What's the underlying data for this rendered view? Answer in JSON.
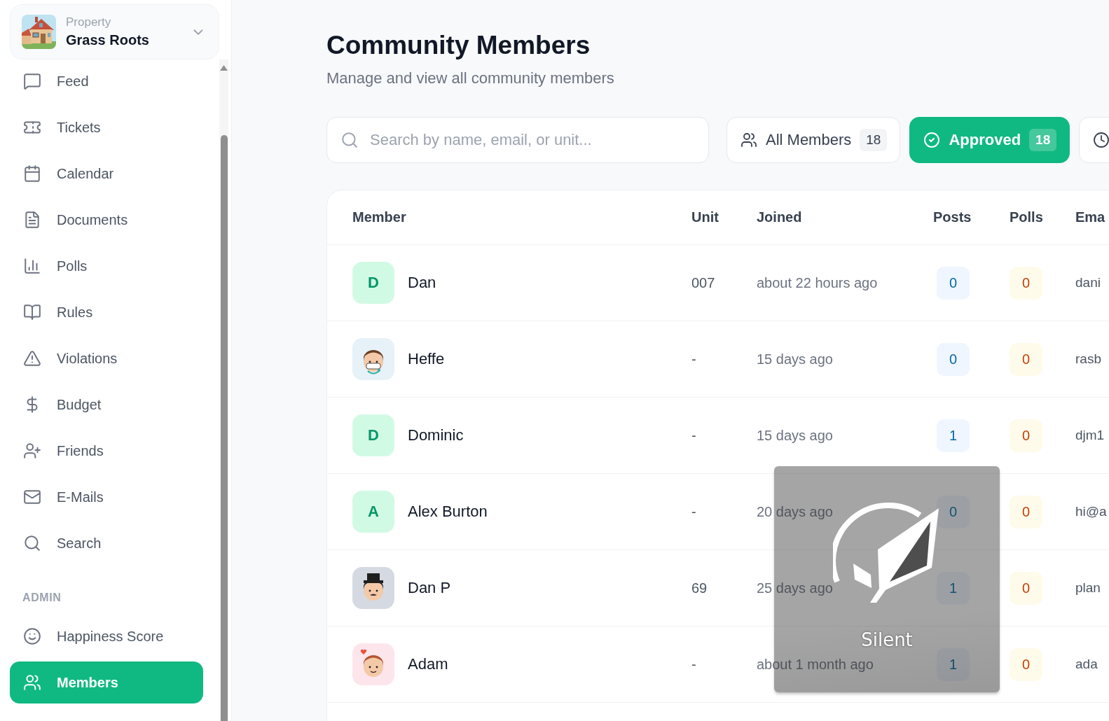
{
  "sidebar": {
    "property": {
      "caption": "Property",
      "name": "Grass Roots"
    },
    "nav": [
      {
        "label": "Feed",
        "selected": false
      },
      {
        "label": "Tickets",
        "selected": false
      },
      {
        "label": "Calendar",
        "selected": false
      },
      {
        "label": "Documents",
        "selected": false
      },
      {
        "label": "Polls",
        "selected": false
      },
      {
        "label": "Rules",
        "selected": false
      },
      {
        "label": "Violations",
        "selected": false
      },
      {
        "label": "Budget",
        "selected": false
      },
      {
        "label": "Friends",
        "selected": false
      },
      {
        "label": "E-Mails",
        "selected": false
      },
      {
        "label": "Search",
        "selected": false
      }
    ],
    "admin": {
      "heading": "ADMIN",
      "items": [
        {
          "label": "Happiness Score",
          "selected": false
        },
        {
          "label": "Members",
          "selected": true
        }
      ]
    }
  },
  "header": {
    "title": "Community Members",
    "subtitle": "Manage and view all community members"
  },
  "search": {
    "placeholder": "Search by name, email, or unit..."
  },
  "filters": [
    {
      "label": "All Members",
      "count": "18",
      "selected": false
    },
    {
      "label": "Approved",
      "count": "18",
      "selected": true
    },
    {
      "selected": false
    }
  ],
  "table": {
    "columns": [
      "Member",
      "Unit",
      "Joined",
      "Posts",
      "Polls",
      "Ema"
    ],
    "rows": [
      {
        "avatar": {
          "kind": "letter",
          "text": "D",
          "color": "#d1fae5"
        },
        "name": "Dan",
        "unit": "007",
        "joined": "about 22 hours ago",
        "posts": "0",
        "polls": "0",
        "email": "dani"
      },
      {
        "avatar": {
          "kind": "masked",
          "color": "#e6f1f8"
        },
        "name": "Heffe",
        "unit": "-",
        "joined": "15 days ago",
        "posts": "0",
        "polls": "0",
        "email": "rasb"
      },
      {
        "avatar": {
          "kind": "letter",
          "text": "D",
          "color": "#d1fae5"
        },
        "name": "Dominic",
        "unit": "-",
        "joined": "15 days ago",
        "posts": "1",
        "polls": "0",
        "email": "djm1"
      },
      {
        "avatar": {
          "kind": "letter",
          "text": "A",
          "color": "#d1fae5"
        },
        "name": "Alex Burton",
        "unit": "-",
        "joined": "20 days ago",
        "posts": "0",
        "polls": "0",
        "email": "hi@a"
      },
      {
        "avatar": {
          "kind": "tophat",
          "color": "#d5d9e2"
        },
        "name": "Dan P",
        "unit": "69",
        "joined": "25 days ago",
        "posts": "1",
        "polls": "0",
        "email": "plan"
      },
      {
        "avatar": {
          "kind": "heart",
          "color": "#fde5ec"
        },
        "name": "Adam",
        "unit": "-",
        "joined": "about 1 month ago",
        "posts": "1",
        "polls": "0",
        "email": "ada"
      }
    ]
  },
  "osd": {
    "label": "Silent"
  }
}
